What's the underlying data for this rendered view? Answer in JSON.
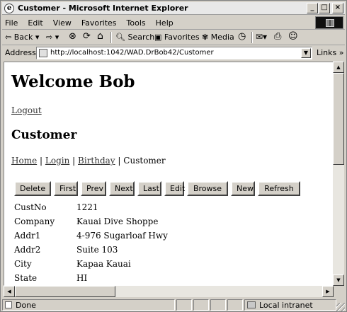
{
  "window": {
    "title": "Customer - Microsoft Internet Explorer",
    "minimize_glyph": "_",
    "maximize_glyph": "□",
    "close_glyph": "×"
  },
  "menu": [
    "File",
    "Edit",
    "View",
    "Favorites",
    "Tools",
    "Help"
  ],
  "toolbar": {
    "back": "⇦ Back ▾",
    "forward": "⇨ ▾",
    "stop": "⊗",
    "refresh": "⟳",
    "home": "⌂",
    "search": "Search",
    "favorites": "Favorites",
    "media": "Media",
    "history": "◷",
    "mail": "✉▾",
    "print": "⎙",
    "messenger": "☺"
  },
  "address": {
    "label": "Address",
    "value": "http://localhost:1042/WAD.DrBob42/Customer",
    "links_label": "Links »"
  },
  "page": {
    "heading": "Welcome Bob",
    "logout_link": "Logout",
    "subheading": "Customer",
    "breadcrumb": {
      "home": "Home",
      "login": "Login",
      "birthday": "Birthday",
      "current": "Customer",
      "separator": "|"
    },
    "buttons": [
      "Delete",
      "First",
      "Prev",
      "Next",
      "Last",
      "Edit",
      "Browse",
      "New",
      "Refresh"
    ],
    "fields": [
      {
        "label": "CustNo",
        "value": "1221"
      },
      {
        "label": "Company",
        "value": "Kauai Dive Shoppe"
      },
      {
        "label": "Addr1",
        "value": "4-976 Sugarloaf Hwy"
      },
      {
        "label": "Addr2",
        "value": "Suite 103"
      },
      {
        "label": "City",
        "value": "Kapaa Kauai"
      },
      {
        "label": "State",
        "value": "HI"
      }
    ]
  },
  "scrollbars": {
    "up_arrow": "▲",
    "down_arrow": "▼",
    "left_arrow": "◀",
    "right_arrow": "▶"
  },
  "status": {
    "text": "Done",
    "zone": "Local intranet"
  }
}
